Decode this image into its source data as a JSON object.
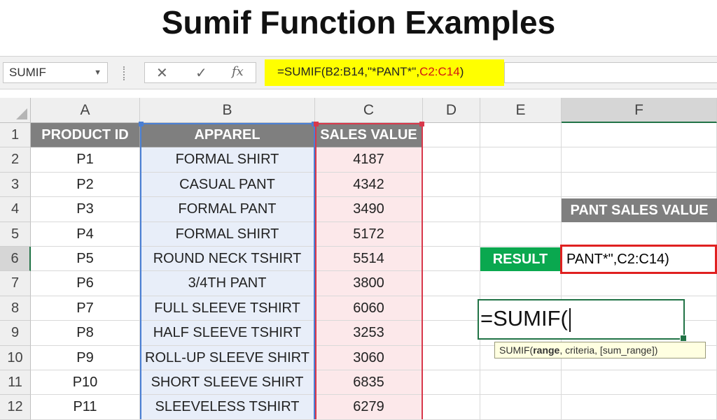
{
  "title": "Sumif Function Examples",
  "formula_bar": {
    "name_box": "SUMIF",
    "cancel_icon": "✕",
    "enter_icon": "✓",
    "fx_label": "fx",
    "formula_a": "=SUMIF(B2:B14,\"*PANT*\",",
    "formula_b": "C2:C14",
    "formula_c": ")"
  },
  "columns": [
    "A",
    "B",
    "C",
    "D",
    "E",
    "F"
  ],
  "rows": [
    "1",
    "2",
    "3",
    "4",
    "5",
    "6",
    "7",
    "8",
    "9",
    "10",
    "11",
    "12"
  ],
  "table": {
    "headers": [
      "PRODUCT ID",
      "APPAREL",
      "SALES VALUE"
    ],
    "data": [
      [
        "P1",
        "FORMAL SHIRT",
        "4187"
      ],
      [
        "P2",
        "CASUAL PANT",
        "4342"
      ],
      [
        "P3",
        "FORMAL PANT",
        "3490"
      ],
      [
        "P4",
        "FORMAL SHIRT",
        "5172"
      ],
      [
        "P5",
        "ROUND NECK TSHIRT",
        "5514"
      ],
      [
        "P6",
        "3/4TH PANT",
        "3800"
      ],
      [
        "P7",
        "FULL SLEEVE TSHIRT",
        "6060"
      ],
      [
        "P8",
        "HALF SLEEVE TSHIRT",
        "3253"
      ],
      [
        "P9",
        "ROLL-UP SLEEVE SHIRT",
        "3060"
      ],
      [
        "P10",
        "SHORT SLEEVE SHIRT",
        "6835"
      ],
      [
        "P11",
        "SLEEVELESS TSHIRT",
        "6279"
      ]
    ]
  },
  "pant_sales_label": "PANT SALES VALUE",
  "result_label": "RESULT",
  "result_value": "PANT*\",C2:C14)",
  "editor_text": "=SUMIF(",
  "tooltip": {
    "fn": "SUMIF(",
    "arg1": "range",
    "rest": ", criteria, [sum_range])"
  },
  "colors": {
    "header_gray": "#7f7f7f",
    "formula_highlight": "#ffff00",
    "result_green": "#0aa84f",
    "range_blue": "#4a7fd4",
    "range_red": "#d8384b",
    "excel_green": "#217346"
  }
}
